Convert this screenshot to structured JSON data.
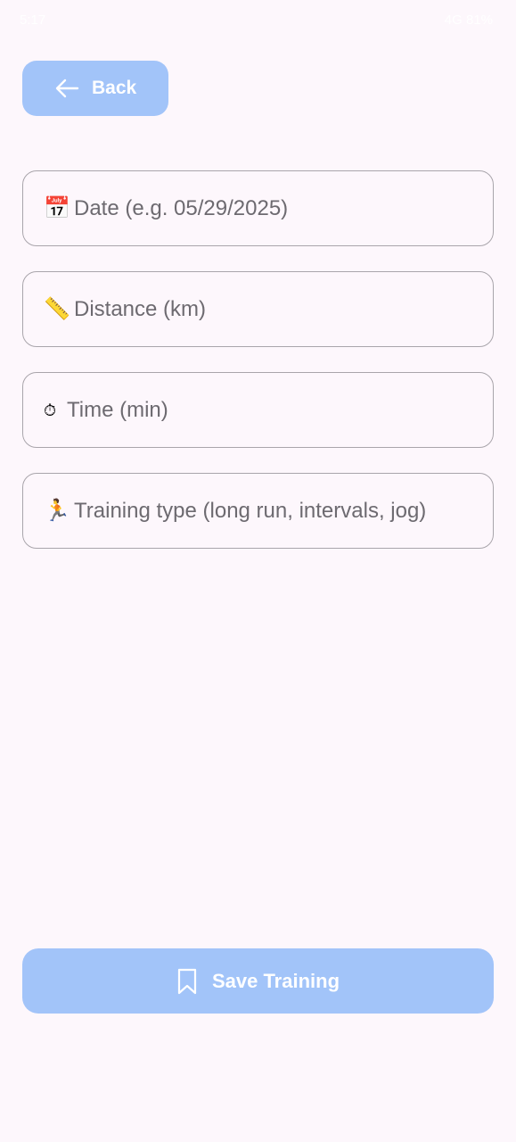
{
  "status_bar": {
    "time": "5:17",
    "right_text": "4G 81%"
  },
  "header": {
    "back_label": "Back"
  },
  "form": {
    "fields": [
      {
        "icon": "📅",
        "icon_name": "calendar-icon",
        "placeholder": "Date (e.g. 05/29/2025)",
        "value": ""
      },
      {
        "icon": "📏",
        "icon_name": "ruler-icon",
        "placeholder": "Distance (km)",
        "value": ""
      },
      {
        "icon": "⏱",
        "icon_name": "stopwatch-icon",
        "placeholder": "Time (min)",
        "value": ""
      },
      {
        "icon": "🏃",
        "icon_name": "runner-icon",
        "placeholder": "Training type (long run, intervals, jog)",
        "value": ""
      }
    ]
  },
  "footer": {
    "save_label": "Save Training"
  },
  "colors": {
    "background": "#fdf7fc",
    "button_fill": "#a2c4f9",
    "field_border": "#a9a5ab",
    "placeholder_text": "#6d6a70"
  }
}
